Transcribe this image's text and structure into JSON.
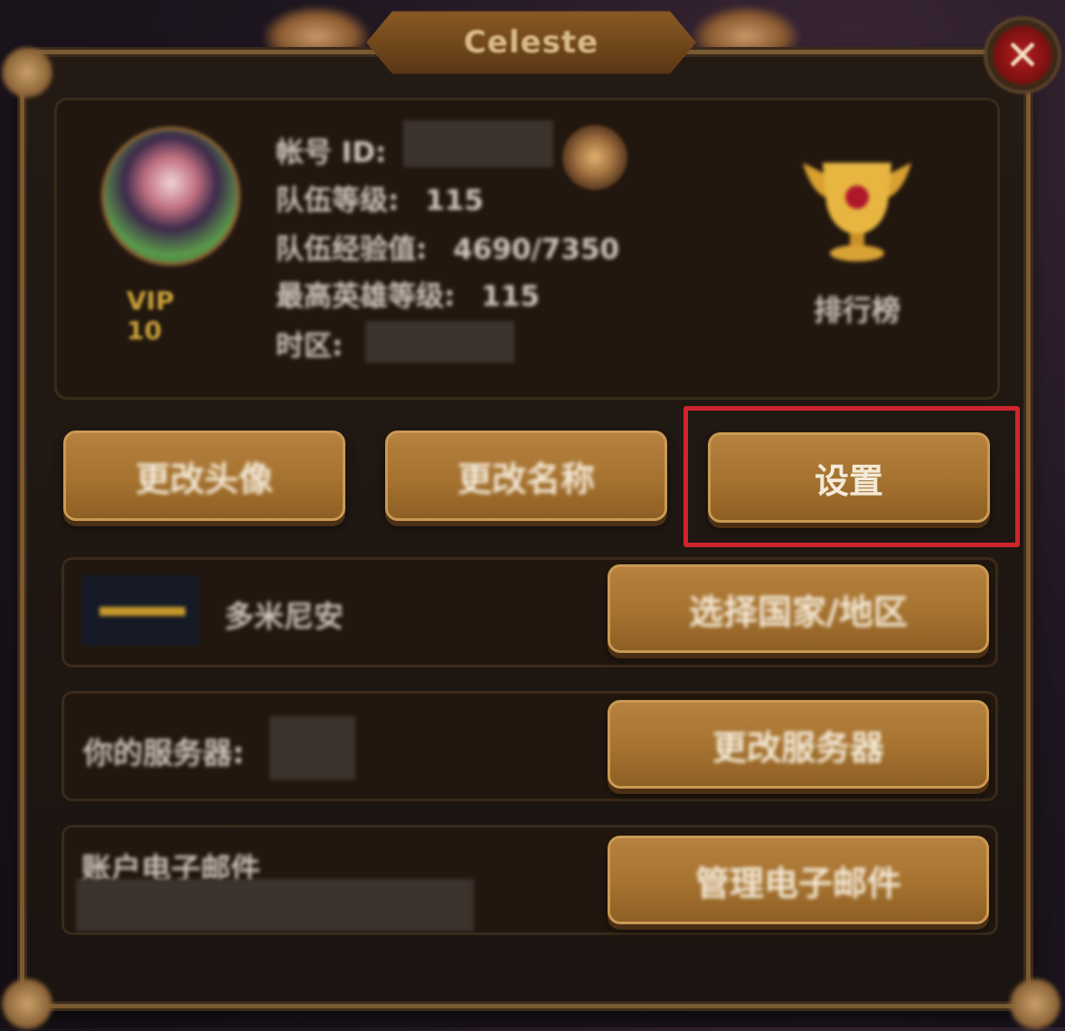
{
  "window": {
    "title": "Celeste"
  },
  "profile": {
    "vip": "VIP 10",
    "account_id_label": "帐号 ID:",
    "team_level_label": "队伍等级:",
    "team_level_value": "115",
    "team_exp_label": "队伍经验值:",
    "team_exp_value": "4690/7350",
    "max_hero_level_label": "最高英雄等级:",
    "max_hero_level_value": "115",
    "timezone_label": "时区:"
  },
  "leaderboard": {
    "label": "排行榜"
  },
  "buttons": {
    "change_avatar": "更改头像",
    "change_name": "更改名称",
    "settings": "设置",
    "select_country": "选择国家/地区",
    "change_server": "更改服务器",
    "manage_email": "管理电子邮件"
  },
  "country": {
    "name": "多米尼安"
  },
  "server": {
    "label": "你的服务器:"
  },
  "email": {
    "label": "账户电子邮件"
  },
  "icons": {
    "close": "close-icon",
    "copy": "coin-icon",
    "trophy": "trophy-icon",
    "flag": "flag-icon"
  },
  "colors": {
    "button": "#a5722f",
    "highlight": "#d0242e",
    "vip": "#c9a23a",
    "panel": "#1b1410"
  }
}
